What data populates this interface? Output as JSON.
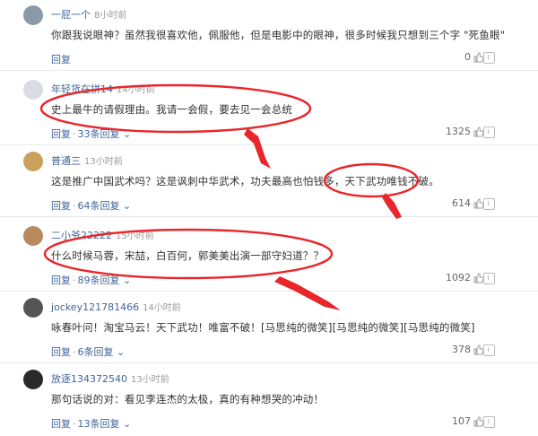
{
  "comments": [
    {
      "user": "一屁一个",
      "time": "8小时前",
      "text": "你跟我说眼神？虽然我很喜欢他，佩服他，但是电影中的眼神，很多时候我只想到三个字 \"死鱼眼\"",
      "reply_label": "回复",
      "reply_count": "",
      "likes": "0",
      "avatar_color": "#8a9aa8"
    },
    {
      "user": "年轻货在拼14",
      "time": "14小时前",
      "text": "史上最牛的请假理由。我请一会假，要去见一会总统",
      "reply_label": "回复",
      "reply_count": "33条回复",
      "likes": "1325",
      "avatar_color": "#d8dde4"
    },
    {
      "user": "普通三",
      "time": "13小时前",
      "text": "这是推广中国武术吗？这是讽刺中华武术，功夫最高也怕钱多，天下武功唯钱不破。",
      "reply_label": "回复",
      "reply_count": "64条回复",
      "likes": "614",
      "avatar_color": "#c9a15a"
    },
    {
      "user": "二小爷22222",
      "time": "15小时前",
      "text": "什么时候马蓉，宋喆，白百何，郭美美出演一部守妇道？？",
      "reply_label": "回复",
      "reply_count": "89条回复",
      "likes": "1092",
      "avatar_color": "#b98a5e"
    },
    {
      "user": "jockey121781466",
      "time": "14小时前",
      "text": "咏春叶问！淘宝马云！天下武功！唯富不破！[马思纯的微笑][马思纯的微笑][马思纯的微笑]",
      "reply_label": "回复",
      "reply_count": "6条回复",
      "likes": "378",
      "avatar_color": "#555555"
    },
    {
      "user": "放逐134372540",
      "time": "13小时前",
      "text": "那句话说的对：看见李连杰的太极，真的有种想哭的冲动！",
      "reply_label": "回复",
      "reply_count": "13条回复",
      "likes": "107",
      "avatar_color": "#2a2a2a"
    }
  ],
  "colors": {
    "annotation": "#e8262b",
    "link": "#406599"
  },
  "icons": {
    "like": "thumbs-up-icon",
    "report": "report-icon",
    "expand": "chevron-down-icon"
  }
}
